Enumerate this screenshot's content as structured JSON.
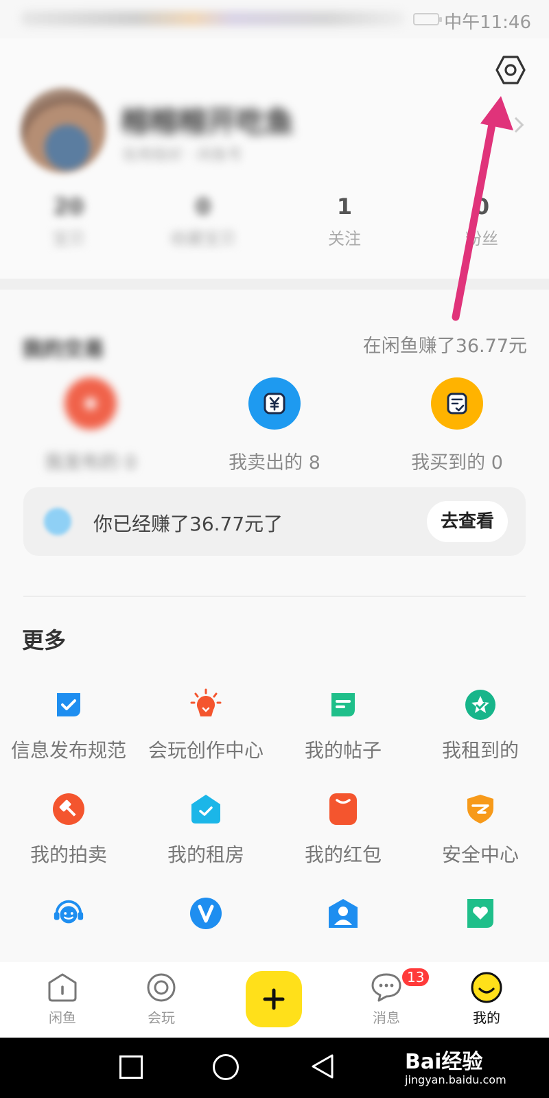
{
  "status_bar": {
    "time": "中午11:46"
  },
  "profile": {
    "nickname": "榕榕榕开吃鱼",
    "subtitle": "信用极好 · 闲鱼号",
    "stats": [
      {
        "value": "20",
        "label": "宝贝"
      },
      {
        "value": "0",
        "label": "收藏宝贝"
      },
      {
        "value": "1",
        "label": "关注"
      },
      {
        "value": "0",
        "label": "粉丝"
      }
    ]
  },
  "trades": {
    "title": "我的交易",
    "earned_summary": "在闲鱼赚了36.77元",
    "items": [
      {
        "label": "我发布的 0",
        "color": "#f0624a"
      },
      {
        "label": "我卖出的 8",
        "color": "#1e9af0"
      },
      {
        "label": "我买到的 0",
        "color": "#ffb300"
      }
    ],
    "earn_bar": {
      "text": "你已经赚了36.77元了",
      "button": "去查看"
    }
  },
  "more": {
    "title": "更多",
    "items": [
      {
        "label": "信息发布规范",
        "icon": "shield-check-icon",
        "color": "#1e8ef0"
      },
      {
        "label": "会玩创作中心",
        "icon": "lightbulb-icon",
        "color": "#f4552e"
      },
      {
        "label": "我的帖子",
        "icon": "post-icon",
        "color": "#1fbf8a"
      },
      {
        "label": "我租到的",
        "icon": "rent-badge-icon",
        "color": "#17b58a"
      },
      {
        "label": "我的拍卖",
        "icon": "gavel-icon",
        "color": "#f4552e"
      },
      {
        "label": "我的租房",
        "icon": "house-check-icon",
        "color": "#1bb6e8"
      },
      {
        "label": "我的红包",
        "icon": "red-envelope-icon",
        "color": "#f4552e"
      },
      {
        "label": "安全中心",
        "icon": "security-shield-icon",
        "color": "#f79a1a"
      },
      {
        "label": "",
        "icon": "customer-service-icon",
        "color": "#1e8ef0"
      },
      {
        "label": "",
        "icon": "vip-icon",
        "color": "#1e8ef0"
      },
      {
        "label": "",
        "icon": "person-icon",
        "color": "#1e8ef0"
      },
      {
        "label": "",
        "icon": "heart-card-icon",
        "color": "#1fbf8a"
      }
    ]
  },
  "tabbar": {
    "tabs": [
      {
        "label": "闲鱼"
      },
      {
        "label": "会玩"
      },
      {
        "label": "消息",
        "badge": "13"
      },
      {
        "label": "我的"
      }
    ]
  },
  "watermark": {
    "main": "Bai经验",
    "sub": "jingyan.baidu.com"
  },
  "colors": {
    "accent": "#ffe01a",
    "annotation_arrow": "#e0337a",
    "badge": "#ff3a3a"
  }
}
